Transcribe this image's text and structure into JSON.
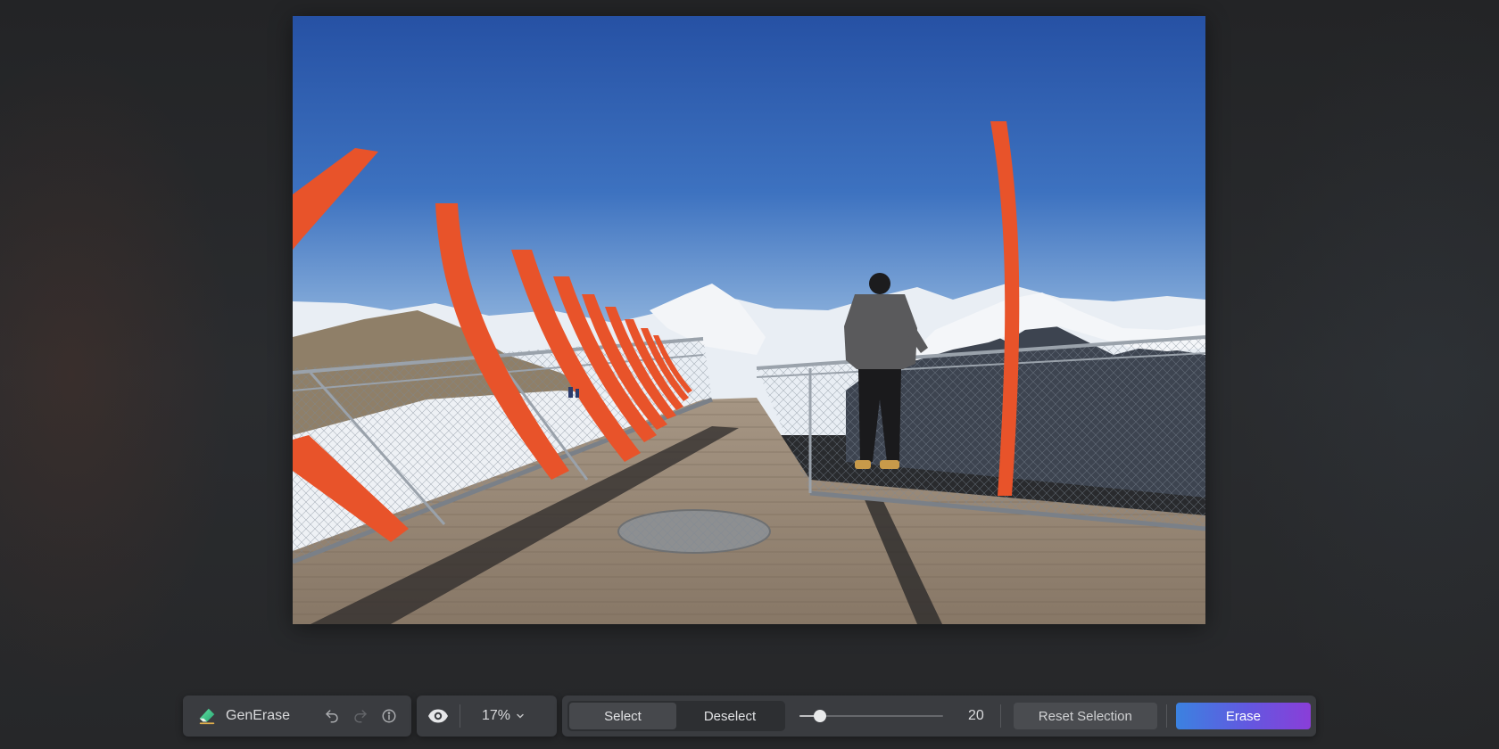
{
  "app": {
    "name": "GenErase",
    "brand_icon": "eraser-icon"
  },
  "toolbar": {
    "undo_icon": "undo-icon",
    "redo_icon": "redo-icon",
    "info_icon": "info-icon",
    "view_icon": "eye-icon",
    "zoom_label": "17%",
    "select_label": "Select",
    "deselect_label": "Deselect",
    "active_mode": "Select",
    "brush_size": "20",
    "brush_size_fraction": 0.14,
    "reset_label": "Reset Selection",
    "erase_label": "Erase"
  },
  "colors": {
    "background": "#26282b",
    "toolbar": "#3a3c40",
    "erase_gradient_start": "#3b82e0",
    "erase_gradient_end": "#8a3ed8",
    "railing_orange": "#e8532a",
    "sky_top": "#2b5aa8",
    "sky_bottom": "#8fb3dc"
  },
  "canvas": {
    "content": "photo"
  }
}
